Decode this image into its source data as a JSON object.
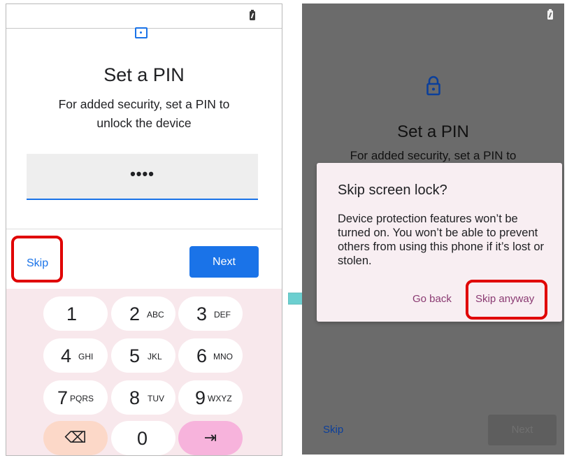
{
  "left_screen": {
    "title": "Set a PIN",
    "description": "For added security, set a PIN to unlock the device",
    "pin_value": "••••",
    "skip_label": "Skip",
    "next_label": "Next",
    "keypad": [
      {
        "num": "1",
        "letters": ""
      },
      {
        "num": "2",
        "letters": "ABC"
      },
      {
        "num": "3",
        "letters": "DEF"
      },
      {
        "num": "4",
        "letters": "GHI"
      },
      {
        "num": "5",
        "letters": "JKL"
      },
      {
        "num": "6",
        "letters": "MNO"
      },
      {
        "num": "7",
        "letters": "PQRS"
      },
      {
        "num": "8",
        "letters": "TUV"
      },
      {
        "num": "9",
        "letters": "WXYZ"
      },
      {
        "num": "0",
        "letters": ""
      }
    ],
    "backspace_glyph": "⌫",
    "enter_glyph": "⇥"
  },
  "right_screen": {
    "title": "Set a PIN",
    "description_partial": "For added security, set a PIN to",
    "skip_label": "Skip",
    "next_label": "Next",
    "dialog": {
      "title": "Skip screen lock?",
      "body": "Device protection features won’t be turned on. You won’t be able to prevent others from using this phone if it’s lost or stolen.",
      "go_back_label": "Go back",
      "skip_anyway_label": "Skip anyway"
    }
  },
  "colors": {
    "accent": "#1a73e8",
    "highlight": "#e00000",
    "keypad_bg": "#f8e8ec",
    "dialog_button": "#8a3a72",
    "arrow": "#6ccfd0"
  },
  "icons": [
    "calendar-icon",
    "battery-icon",
    "lock-icon",
    "backspace-icon",
    "enter-icon",
    "arrow-right-icon"
  ]
}
